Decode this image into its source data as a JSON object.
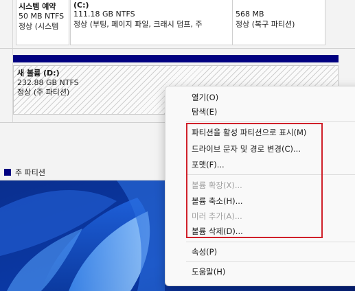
{
  "partitions": [
    {
      "name": "시스템 예약",
      "size": "50 MB NTFS",
      "status": "정상 (시스템"
    },
    {
      "name": "(C:)",
      "size": "111.18 GB NTFS",
      "status": "정상 (부팅, 페이지 파일, 크래시 덤프, 주"
    },
    {
      "name": "",
      "size": "568 MB",
      "status": "정상 (복구 파티션)"
    }
  ],
  "volume": {
    "name": "새 볼륨  (D:)",
    "size": "232.88 GB NTFS",
    "status": "정상 (주 파티션)"
  },
  "legend": {
    "label": "주 파티션",
    "color": "#000080"
  },
  "context_menu": {
    "items": [
      {
        "label": "열기(O)",
        "enabled": true
      },
      {
        "label": "탐색(E)",
        "enabled": true
      },
      {
        "label": "파티션을 활성 파티션으로 표시(M)",
        "enabled": true
      },
      {
        "label": "드라이브 문자 및 경로 변경(C)...",
        "enabled": true
      },
      {
        "label": "포맷(F)...",
        "enabled": true
      },
      {
        "label": "볼륨 확장(X)...",
        "enabled": false
      },
      {
        "label": "볼륨 축소(H)...",
        "enabled": true
      },
      {
        "label": "미러 추가(A)...",
        "enabled": false
      },
      {
        "label": "볼륨 삭제(D)...",
        "enabled": true
      },
      {
        "label": "속성(P)",
        "enabled": true
      },
      {
        "label": "도움말(H)",
        "enabled": true
      }
    ],
    "highlight_color": "#d0202a"
  }
}
